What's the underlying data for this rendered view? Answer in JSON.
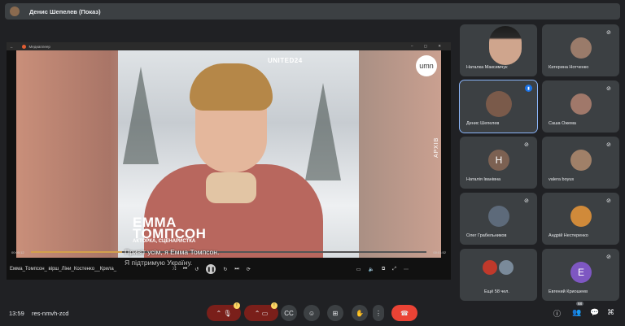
{
  "topbar": {
    "title": "Денис Шепелев (Показ)"
  },
  "player": {
    "window_title": "Медиаплеер",
    "time_current": "00:00:12",
    "time_total": "00:01:52",
    "progress": 0.23,
    "file_title": "Емма_Томпсон_ вірш_Ліни_Костенко__Крила_",
    "overlay": {
      "logo": "UNITED24",
      "name_line1": "ЕММА",
      "name_line2": "ТОМПСОН",
      "role": "АКТОРКА, СЦЕНАРИСТКА",
      "badge": "umn",
      "side_label": "АРХІВ"
    },
    "subtitle_line1": "Привіт усім, я Емма Томпсон.",
    "subtitle_line2": "Я підтримую Україну."
  },
  "participants": [
    {
      "name": "Наталка Максимчук",
      "type": "camera"
    },
    {
      "name": "Катерина Нотченко",
      "type": "avatar",
      "muted": true
    },
    {
      "name": "Денис Шепелев",
      "type": "avatar",
      "speaking": true
    },
    {
      "name": "Саша Ожема",
      "type": "avatar",
      "muted": true
    },
    {
      "name": "Наталія Іванівна",
      "type": "letter",
      "letter": "Н",
      "muted": true
    },
    {
      "name": "valera boyus",
      "type": "avatar",
      "muted": true
    },
    {
      "name": "Олег Грабельников",
      "type": "avatar",
      "muted": true
    },
    {
      "name": "Андрій Нестеренко",
      "type": "avatar",
      "muted": true
    },
    {
      "name": "Ещё 58 чел.",
      "type": "group"
    },
    {
      "name": "Евгений Криошеев",
      "type": "letter",
      "letter": "E",
      "muted": true
    }
  ],
  "bottombar": {
    "time": "13:59",
    "meeting_code": "res-nmvh-zcd",
    "mic_badge": "!",
    "cam_badge": "!",
    "people_count": "68"
  },
  "icons": {
    "mic_off": "mic-off-icon",
    "cam_off": "camera-off-icon",
    "captions": "captions-icon",
    "emoji": "emoji-icon",
    "present": "present-icon",
    "hand": "raise-hand-icon",
    "more": "more-icon",
    "leave": "leave-call-icon",
    "info": "info-icon",
    "people": "people-icon",
    "chat": "chat-icon",
    "activities": "activities-icon"
  },
  "colors": {
    "background": "#202124",
    "tile": "#3c4043",
    "leave": "#ea4335",
    "speaking": "#8ab4f8",
    "progress": "#d2a04c"
  }
}
